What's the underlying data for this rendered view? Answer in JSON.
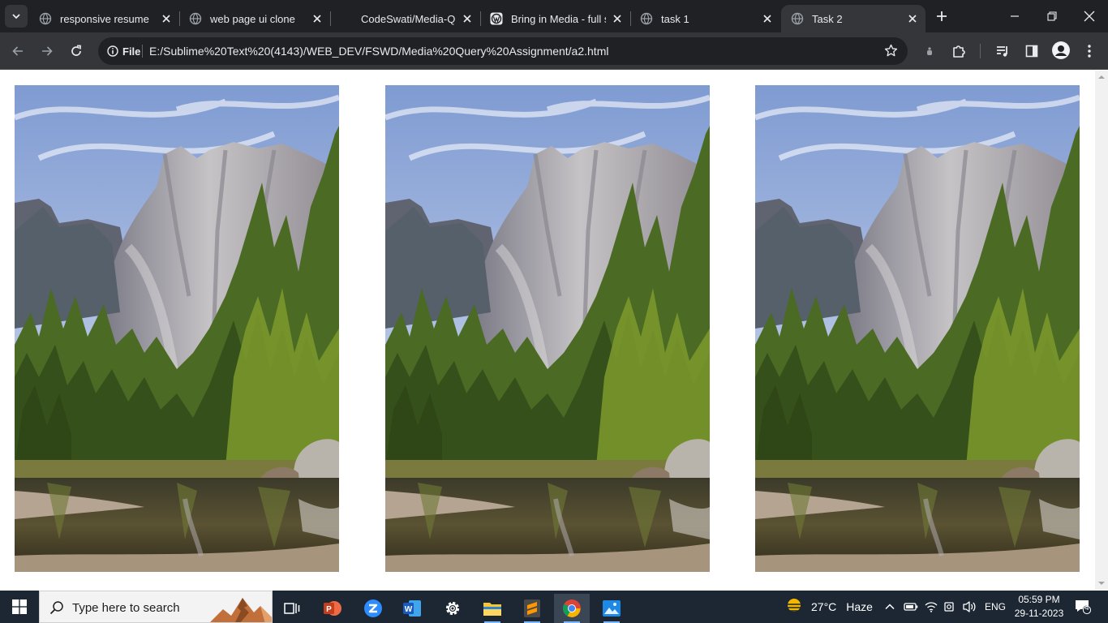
{
  "browser": {
    "tabs": [
      {
        "title": "responsive resume",
        "favicon": "globe-icon"
      },
      {
        "title": "web page ui clone",
        "favicon": "globe-icon"
      },
      {
        "title": "CodeSwati/Media-Qu",
        "favicon": "github-icon"
      },
      {
        "title": "Bring in Media - full s",
        "favicon": "wordpress-icon"
      },
      {
        "title": "task 1",
        "favicon": "globe-icon"
      },
      {
        "title": "Task 2",
        "favicon": "globe-icon",
        "active": true
      }
    ],
    "address_bar": {
      "chip_label": "File",
      "url": "E:/Sublime%20Text%20(4143)/WEB_DEV/FSWD/Media%20Query%20Assignment/a2.html"
    }
  },
  "page": {
    "images": [
      {
        "alt": "Yosemite cliff with pine trees reflected in river"
      },
      {
        "alt": "Yosemite cliff with pine trees reflected in river"
      },
      {
        "alt": "Yosemite cliff with pine trees reflected in river"
      }
    ]
  },
  "taskbar": {
    "search_placeholder": "Type here to search",
    "weather_temp": "27°C",
    "weather_desc": "Haze",
    "language": "ENG",
    "time": "05:59 PM",
    "date": "29-11-2023",
    "notification_count": "4"
  },
  "colors": {
    "tab_strip": "#202124",
    "toolbar": "#35363a",
    "taskbar": "#1c2733",
    "accent": "#7ab8ff"
  }
}
